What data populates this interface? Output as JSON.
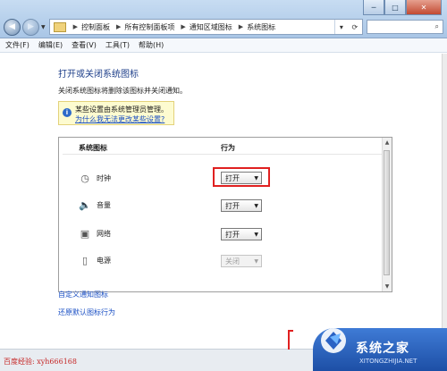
{
  "titlebar": {
    "controls": {
      "minimize": "─",
      "maximize": "□",
      "close": "✕"
    },
    "breadcrumbs": [
      "控制面板",
      "所有控制面板项",
      "通知区域图标",
      "系统图标"
    ]
  },
  "menu": [
    "文件(F)",
    "编辑(E)",
    "查看(V)",
    "工具(T)",
    "帮助(H)"
  ],
  "main": {
    "title": "打开或关闭系统图标",
    "description": "关闭系统图标将删除该图标并关闭通知。",
    "notice": {
      "text": "某些设置由系统管理员管理。",
      "link": "为什么我无法更改某些设置?"
    },
    "table": {
      "col_icon": "系统图标",
      "col_behavior": "行为",
      "rows": [
        {
          "icon": "clock-icon",
          "label": "时钟",
          "value": "打开",
          "enabled": true,
          "highlighted": true
        },
        {
          "icon": "volume-icon",
          "label": "音量",
          "value": "打开",
          "enabled": true
        },
        {
          "icon": "network-icon",
          "label": "网络",
          "value": "打开",
          "enabled": true
        },
        {
          "icon": "power-icon",
          "label": "电源",
          "value": "关闭",
          "enabled": false
        }
      ]
    },
    "links": {
      "customize": "自定义通知图标",
      "restore": "还原默认图标行为"
    }
  },
  "footer": {
    "watermark": "百度经验: xyh666168",
    "logo_text": "系统之家",
    "logo_sub": "XITONGZHIJIA.NET"
  },
  "colors": {
    "accent": "#1a4fc4",
    "highlight": "#e02020",
    "notice_bg": "#fdfbd0"
  }
}
